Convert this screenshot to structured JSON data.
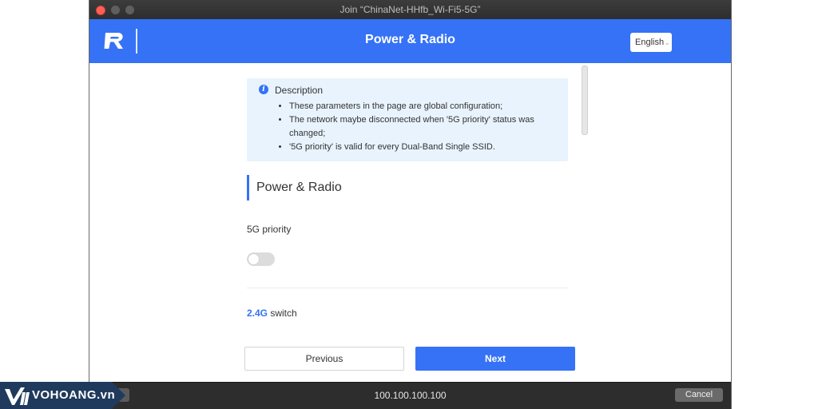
{
  "window": {
    "title": "Join “ChinaNet-HHfb_Wi-Fi5-5G”"
  },
  "header": {
    "title": "Power & Radio",
    "language": "English"
  },
  "description": {
    "title": "Description",
    "items": [
      "These parameters in the page are global configuration;",
      "The network maybe disconnected when '5G priority' status was changed;",
      "'5G priority' is valid for every Dual-Band Single SSID."
    ]
  },
  "section": {
    "title": "Power & Radio"
  },
  "fields": {
    "priority_label": "5G priority",
    "priority_enabled": false,
    "switch_highlight": "2.4G",
    "switch_label": " switch"
  },
  "buttons": {
    "previous": "Previous",
    "next": "Next"
  },
  "bottombar": {
    "url": "100.100.100.100",
    "cancel": "Cancel"
  },
  "watermark": {
    "text": "VOHOANG.vn"
  }
}
